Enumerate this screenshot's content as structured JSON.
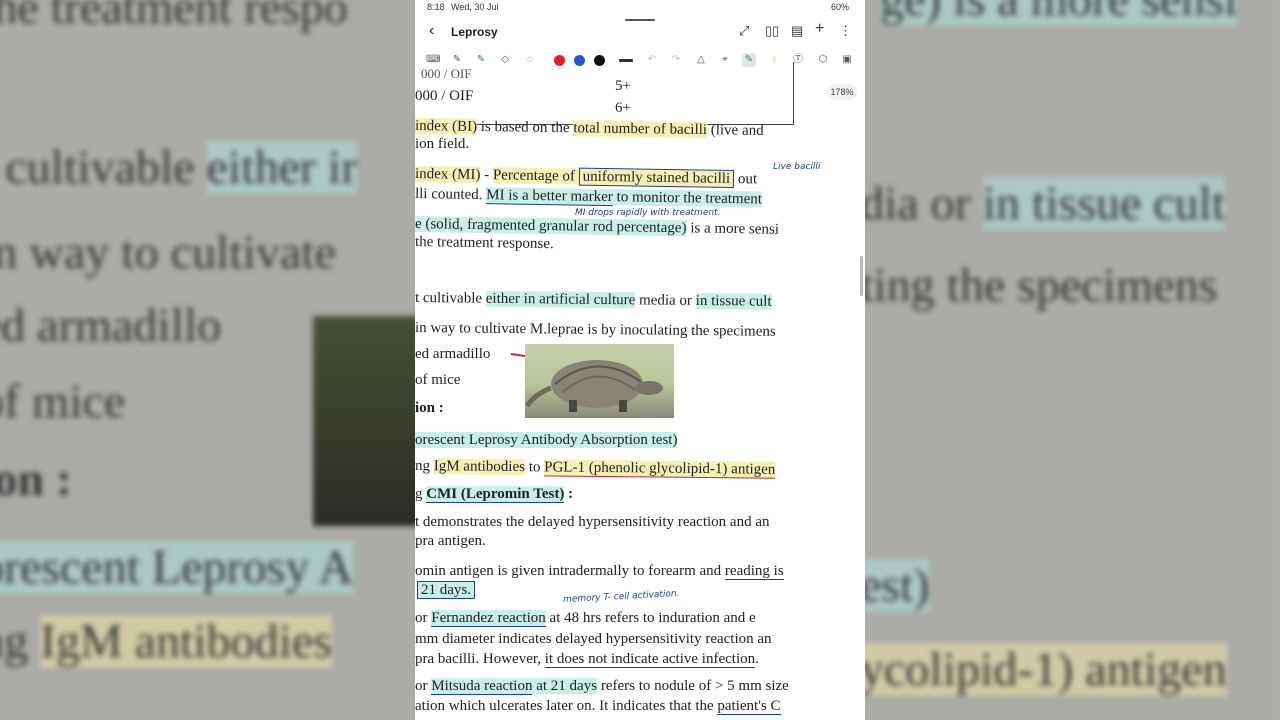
{
  "status_bar": {
    "time": "8:18",
    "date": "Wed, 30 Jul",
    "battery": "60%"
  },
  "app": {
    "title": "Leprosy",
    "zoom": "178%",
    "pen_colors": [
      "#e02020",
      "#1f57d6",
      "#111111"
    ]
  },
  "document": {
    "table_rows": [
      {
        "left": "000 / OIF",
        "right": "5+"
      },
      {
        "left": "000 / OIF",
        "right": "6+"
      }
    ],
    "lines": {
      "bi_line1_a": "index (BI)",
      "bi_line1_b": " is based on the ",
      "bi_line1_c": "total number of bacilli",
      "bi_line1_d": " (live and",
      "bi_line2": "ion field.",
      "mi_line1_a": "index (MI)",
      "mi_line1_b": " - ",
      "mi_line1_c": "Percentage of ",
      "mi_line1_d": "uniformly stained bacilli",
      "mi_line1_e": " out",
      "mi_line2_a": "lli counted. ",
      "mi_line2_b": "MI is a better marker",
      "mi_line2_c": " to monitor the treatment",
      "mi_line3_a": "e (solid, fragmented granular rod percentage)",
      "mi_line3_b": " is a more sensi",
      "mi_line4": "the treatment response.",
      "cult_line1_a": "t cultivable ",
      "cult_line1_b": "either in artificial culture",
      "cult_line1_c": " media or ",
      "cult_line1_d": "in tissue cult",
      "cult_line2": "in way to cultivate M.leprae is by inoculating the specimens",
      "cult_line3": "ed armadillo",
      "cult_line4": "of mice",
      "section": "ion :",
      "fla_line": "orescent Leprosy Antibody Absorption test)",
      "igm_a": "ng ",
      "igm_b": "IgM antibodies",
      "igm_c": " to ",
      "igm_d": "PGL-1 (phenolic glycolipid-1) antigen",
      "cmi_a": "g ",
      "cmi_b": "CMI (Lepromin Test)",
      "cmi_c": " :",
      "dem_1": "t demonstrates the delayed hypersensitivity reaction and an",
      "dem_2": "pra antigen.",
      "omin_a": "omin antigen is given intradermally to forearm and ",
      "omin_b": "reading is",
      "days": "21 days.",
      "fern_a": "or ",
      "fern_b": "Fernandez reaction",
      "fern_c": " at 48 hrs refers to induration and e",
      "mm_line": "mm diameter indicates delayed hypersensitivity reaction an",
      "pra_a": "pra bacilli. However, ",
      "pra_b": "it does not indicate active infection",
      "pra_c": ".",
      "mits_a": "or ",
      "mits_b": "Mitsuda reaction",
      "mits_c": " at 21 days",
      "mits_d": " refers to nodule of > 5 mm size",
      "last_a": "ation which ulcerates later on. It indicates that the ",
      "last_b": "patient's C"
    },
    "handwritten": {
      "live_bacilli": "Live bacilli",
      "mi_drops": "MI drops rapidly with treatment.",
      "memory": "memory T- cell activation."
    }
  },
  "background_text": {
    "bg1": "the treatment respo",
    "bg1r": "ge) is a more sensi",
    "bg2": "t cultivable ",
    "bg2b": "either ir",
    "bg2r": "dia or ",
    "bg2rb": "in tissue cult",
    "bg3": "in way to cultivate",
    "bg3r": "ting the specimens",
    "bg4": "ed armadillo",
    "bg5": "of mice",
    "bg6": "ion :",
    "bg7": "orescent Leprosy A",
    "bg7r": "est)",
    "bg8": "ng ",
    "bg8b": "IgM antibodies",
    "bg8r": "ycolipid-1) antigen"
  }
}
